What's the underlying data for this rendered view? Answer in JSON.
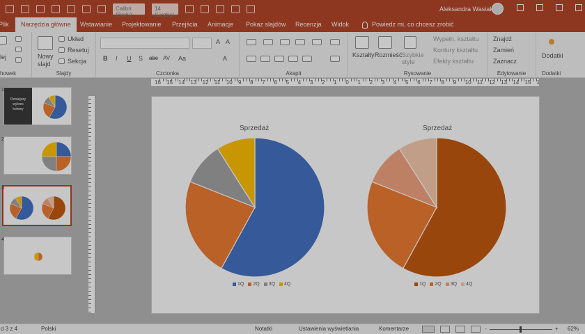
{
  "titlebar": {
    "font_box": "Calibri (Body)",
    "size_box": "14 (Liczba)",
    "user": "Aleksandra Wasiak"
  },
  "tabs": [
    {
      "label": "Plik",
      "active": false
    },
    {
      "label": "Narzędzia główne",
      "active": true
    },
    {
      "label": "Wstawianie",
      "active": false
    },
    {
      "label": "Projektowanie",
      "active": false
    },
    {
      "label": "Przejścia",
      "active": false
    },
    {
      "label": "Animacje",
      "active": false
    },
    {
      "label": "Pokaz slajdów",
      "active": false
    },
    {
      "label": "Recenzja",
      "active": false
    },
    {
      "label": "Widok",
      "active": false
    }
  ],
  "tell_me": "Powiedz mi, co chcesz zrobić",
  "ribbon": {
    "groups": {
      "schowek": "howek",
      "slajdy": "Slajdy",
      "czcionka": "Czcionka",
      "akapit": "Akapit",
      "rysowanie": "Rysowanie",
      "edytowanie": "Edytowanie",
      "dodatki": "Dodatki"
    },
    "wklej": "lej",
    "nowy_slajd": "Nowy slajd",
    "uklad": "Układ",
    "resetuj": "Resetuj",
    "sekcja": "Sekcja",
    "font_buttons": [
      "B",
      "I",
      "U",
      "S",
      "abc",
      "AV",
      "Aa",
      "A"
    ],
    "ksztalty": "Kształty",
    "rozmiesc": "Rozmieść",
    "szybkie_style": "Szybkie style",
    "wypelnienie": "Wypełn. kształtu",
    "kontury": "Kontury kształtu",
    "efekty": "Efekty kształtu",
    "znajdz": "Znajdź",
    "zamien": "Zamień",
    "zaznacz": "Zaznacz",
    "dodatki_btn": "Dodatki"
  },
  "ruler_numbers": [
    "16",
    "15",
    "14",
    "13",
    "12",
    "11",
    "10",
    "9",
    "8",
    "7",
    "6",
    "5",
    "4",
    "3",
    "2",
    "1",
    "0",
    "1",
    "2",
    "3",
    "4",
    "5",
    "6",
    "7",
    "8",
    "9",
    "10",
    "11",
    "12",
    "13",
    "14",
    "15",
    "16"
  ],
  "thumbs": [
    {
      "num": "1",
      "title_lines": [
        "Dzisiejszy",
        "wykres",
        "kołowy"
      ]
    },
    {
      "num": "2"
    },
    {
      "num": "3"
    },
    {
      "num": "4"
    }
  ],
  "chart_data": [
    {
      "type": "pie",
      "title": "Sprzedaż",
      "categories": [
        "1Q",
        "2Q",
        "3Q",
        "4Q"
      ],
      "values": [
        58,
        23,
        10,
        9
      ],
      "colors": [
        "#4472c4",
        "#ed7d31",
        "#a5a5a5",
        "#ffc000"
      ]
    },
    {
      "type": "pie",
      "title": "Sprzedaż",
      "categories": [
        "1Q",
        "2Q",
        "3Q",
        "4Q"
      ],
      "values": [
        58,
        23,
        10,
        9
      ],
      "colors": [
        "#c55a11",
        "#ed7d31",
        "#f4a582",
        "#f8cbad"
      ]
    }
  ],
  "status": {
    "slide_info": "d 3 z 4",
    "language": "Polski",
    "notes": "Notatki",
    "display_settings": "Ustawienia wyświetlania",
    "comments": "Komentarze",
    "zoom": "62%",
    "zoom_minus": "-",
    "zoom_plus": "+"
  }
}
